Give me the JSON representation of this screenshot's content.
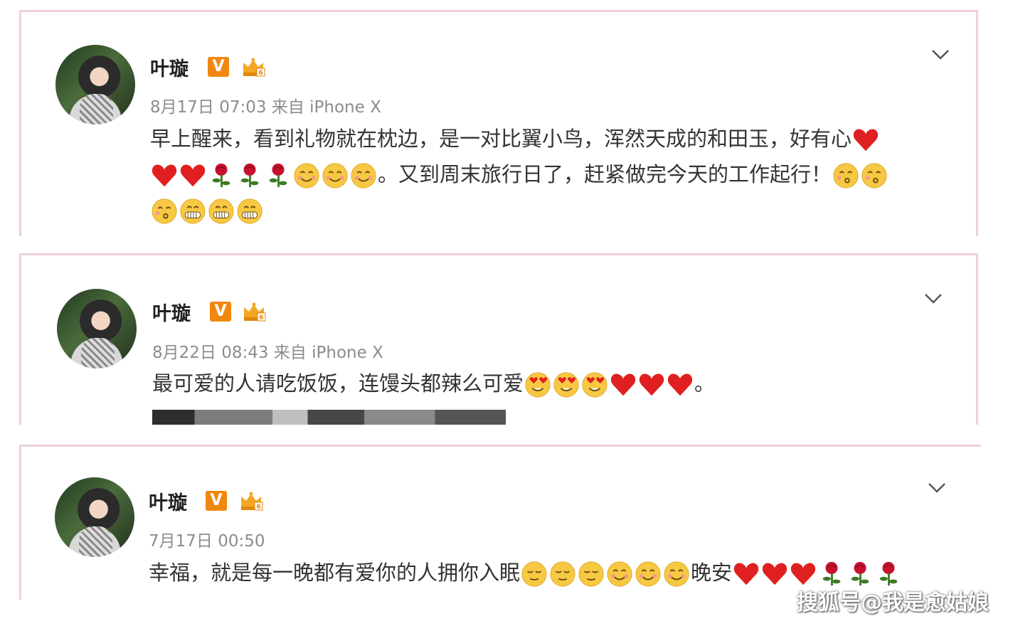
{
  "posts": [
    {
      "name": "叶璇",
      "meta": "8月17日 07:03 来自 iPhone X",
      "line1": "早上醒来，看到礼物就在枕边，是一对比翼小鸟，浑然天成的和田玉，好有心",
      "line2_text": "。又到周末旅行日了，赶紧做完今天的工作起行！"
    },
    {
      "name": "叶璇",
      "meta": "8月22日 08:43 来自 iPhone X",
      "line1": "最可爱的人请吃饭饭，连馒头都辣么可爱",
      "line1_end": "。"
    },
    {
      "name": "叶璇",
      "meta": "7月17日 00:50",
      "line1": "幸福，就是每一晚都有爱你的人拥你入眠",
      "line1_mid": "晚安"
    }
  ],
  "badges": {
    "v": "V"
  },
  "icons": [
    "avatar-image",
    "verified-v-icon",
    "vip-crown-icon",
    "chevron-down-icon",
    "heart-emoji",
    "rose-emoji",
    "smile-emoji",
    "kiss-emoji",
    "grin-emoji",
    "heart-eyes-emoji",
    "sleepy-emoji"
  ],
  "watermark": "搜狐号@我是愈姑娘",
  "colors": {
    "border": "#efd1dd",
    "badge": "#f0870f",
    "heart": "#e02020",
    "emoji": "#f7c843"
  }
}
